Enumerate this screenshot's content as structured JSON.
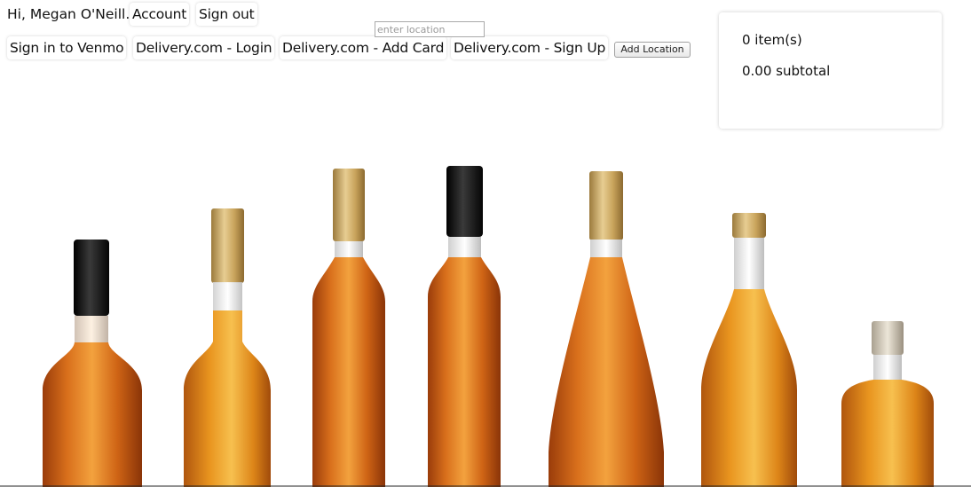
{
  "header": {
    "greeting": "Hi, Megan O'Neill.",
    "account_label": "Account",
    "signout_label": "Sign out"
  },
  "links": [
    {
      "label": "Sign in to Venmo"
    },
    {
      "label": "Delivery.com - Login"
    },
    {
      "label": "Delivery.com - Add Card"
    },
    {
      "label": "Delivery.com - Sign Up"
    }
  ],
  "location": {
    "placeholder": "enter location",
    "value": "",
    "add_button_label": "Add Location"
  },
  "cart": {
    "items_text": "0 item(s)",
    "subtotal_text": "0.00 subtotal"
  },
  "hero": {
    "image_subject": "bottles-of-liquor"
  },
  "colors": {
    "background": "#ffffff",
    "amber": "#d8741e",
    "gold_cap": "#c9a45c",
    "black_cap": "#1a1a1a"
  }
}
